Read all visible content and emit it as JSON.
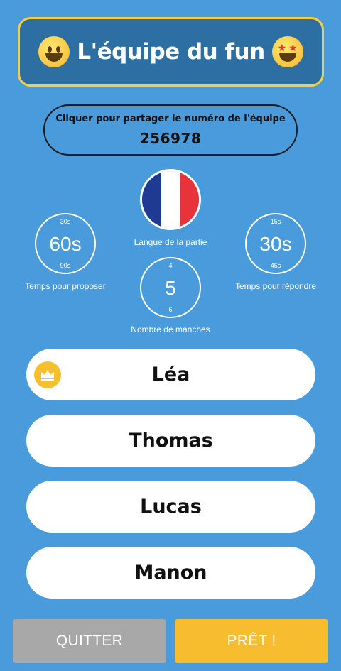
{
  "header": {
    "title": "L'équipe du fun",
    "left_emoji": "grinning-face-icon",
    "right_emoji": "star-struck-icon"
  },
  "share": {
    "label": "Cliquer pour partager le numéro de l'équipe",
    "code": "256978"
  },
  "language": {
    "label": "Langue de la partie",
    "flag": "france-flag-icon",
    "flag_colors": [
      "#1f3a93",
      "#ffffff",
      "#e8333a"
    ]
  },
  "settings": {
    "propose_time": {
      "min": "30s",
      "value": "60s",
      "max": "90s",
      "label": "Temps pour proposer"
    },
    "answer_time": {
      "min": "15s",
      "value": "30s",
      "max": "45s",
      "label": "Temps pour répondre"
    },
    "rounds": {
      "min": "4",
      "value": "5",
      "max": "6",
      "label": "Nombre de manches"
    }
  },
  "players": [
    {
      "name": "Léa",
      "host": true
    },
    {
      "name": "Thomas",
      "host": false
    },
    {
      "name": "Lucas",
      "host": false
    },
    {
      "name": "Manon",
      "host": false
    }
  ],
  "buttons": {
    "quit": "QUITTER",
    "ready": "PRÊT !"
  },
  "colors": {
    "background": "#4a9bdb",
    "title_box": "#2e6fa3",
    "title_border": "#f4cf3e",
    "quit": "#a8a8a8",
    "ready": "#f8bd2e",
    "crown": "#f5c02e"
  }
}
